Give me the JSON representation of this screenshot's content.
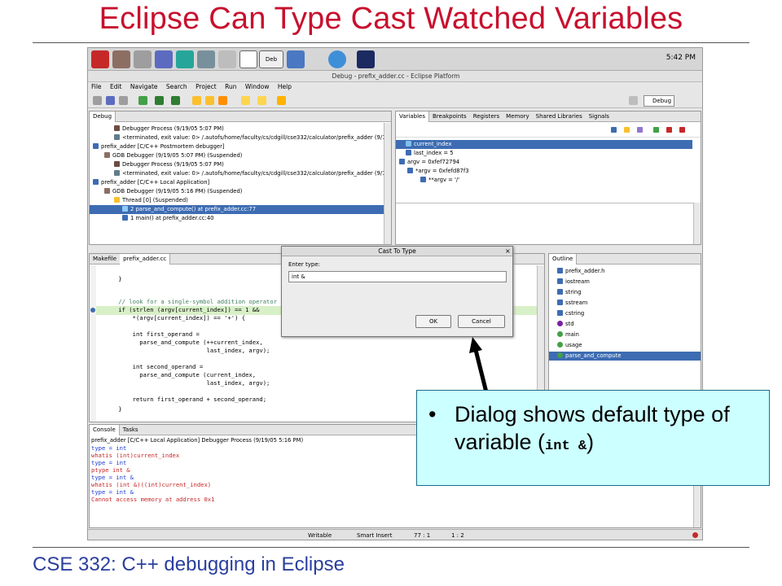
{
  "slide": {
    "title": "Eclipse Can Type Cast Watched Variables",
    "footer": "CSE 332: C++ debugging in Eclipse"
  },
  "desktop": {
    "taskbar_button": "Deb",
    "clock": "5:42 PM",
    "window_title": "Debug - prefix_adder.cc - Eclipse Platform"
  },
  "menu": [
    "File",
    "Edit",
    "Navigate",
    "Search",
    "Project",
    "Run",
    "Window",
    "Help"
  ],
  "perspective": "Debug",
  "debug_view": {
    "tab": "Debug",
    "rows": [
      "Debugger Process (9/19/05 5:07 PM)",
      "<terminated, exit value: 0> /.autofs/home/faculty/cs/cdgill/cse332/calculator/prefix_adder (9/19/05",
      "prefix_adder [C/C++ Postmortem debugger]",
      "GDB Debugger (9/19/05 5:07 PM) (Suspended)",
      "Debugger Process (9/19/05 5:07 PM)",
      "<terminated, exit value: 0> /.autofs/home/faculty/cs/cdgill/cse332/calculator/prefix_adder (9/19/05",
      "prefix_adder [C/C++ Local Application]",
      "GDB Debugger (9/19/05 5:16 PM) (Suspended)",
      "Thread [0] (Suspended)",
      "2 parse_and_compute() at prefix_adder.cc:77",
      "1 main() at prefix_adder.cc:40"
    ]
  },
  "variables_view": {
    "tabs": [
      "Variables",
      "Breakpoints",
      "Registers",
      "Memory",
      "Shared Libraries",
      "Signals"
    ],
    "rows": [
      "current_index",
      "last_index = 5",
      "argv = 0xfef72794",
      "*argv = 0xfefd87f3",
      "**argv = '/'"
    ]
  },
  "editor": {
    "tabs": [
      "Makefile",
      "prefix_adder.cc"
    ],
    "lines": [
      "    }",
      "",
      "    // look for a single-symbol addition operator",
      "    if (strlen (argv[current_index]) == 1 &&",
      "        *(argv[current_index]) == '+') {",
      "",
      "        int first_operand =",
      "          parse_and_compute (++current_index,",
      "                             last_index, argv);",
      "",
      "        int second_operand =",
      "          parse_and_compute (current_index,",
      "                             last_index, argv);",
      "",
      "        return first_operand + second_operand;",
      "    }"
    ]
  },
  "outline": {
    "tab": "Outline",
    "items": [
      "prefix_adder.h",
      "iostream",
      "string",
      "sstream",
      "cstring",
      "std",
      "main",
      "usage",
      "parse_and_compute"
    ]
  },
  "console": {
    "tabs": [
      "Console",
      "Tasks"
    ],
    "header": "prefix_adder [C/C++ Local Application] Debugger Process (9/19/05 5:16 PM)",
    "lines": [
      "type = int",
      "whatis (int)current_index",
      "type = int",
      "ptype int &",
      "type = int &",
      "whatis (int &)((int)current_index)",
      "type = int &",
      "Cannot access memory at address 0x1"
    ]
  },
  "status": {
    "mode": "Writable",
    "insert": "Smart Insert",
    "pos": "77 : 1",
    "col": "1 : 2"
  },
  "dialog": {
    "title": "Cast To Type",
    "label": "Enter type:",
    "value": "int &",
    "ok": "OK",
    "cancel": "Cancel"
  },
  "callout": {
    "bullet": "•",
    "text_before": "Dialog shows default type of variable (",
    "code": "int &",
    "text_after": ")"
  },
  "colors": {
    "title": "#c8102e",
    "footer": "#2a3f9e",
    "callout_bg": "#ccffff",
    "selection": "#3d6cb2"
  }
}
